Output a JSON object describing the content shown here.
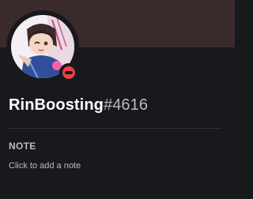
{
  "profile": {
    "name": "RinBoosting",
    "discriminator": "#4616",
    "status": "do-not-disturb"
  },
  "note": {
    "heading": "NOTE",
    "placeholder": "Click to add a note"
  },
  "colors": {
    "banner": "#3b2a2c",
    "background": "#18191c",
    "status_dnd": "#ed4245"
  },
  "icons": {
    "status": "do-not-disturb-icon"
  }
}
